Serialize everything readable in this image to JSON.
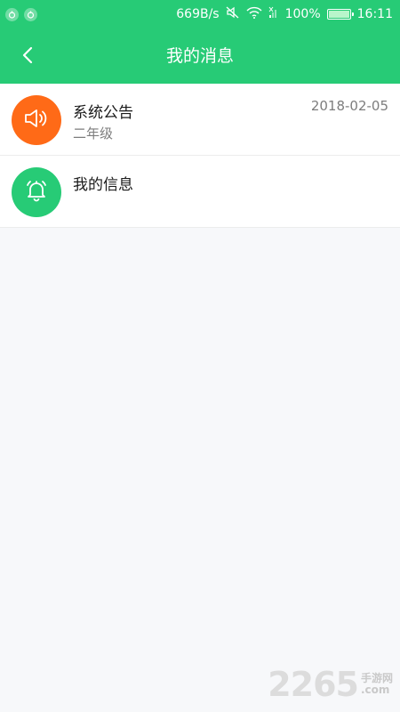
{
  "status_bar": {
    "network_speed": "669B/s",
    "battery_percent": "100%",
    "time": "16:11",
    "icons": [
      "app-icon",
      "app-icon",
      "mute-icon",
      "wifi-icon",
      "no-signal-icon",
      "battery-icon"
    ]
  },
  "header": {
    "title": "我的消息",
    "background_color": "#27cb76"
  },
  "messages": [
    {
      "title": "系统公告",
      "subtitle": "二年级",
      "date": "2018-02-05",
      "icon": "speaker-icon",
      "icon_color": "#ff6a17"
    },
    {
      "title": "我的信息",
      "subtitle": "",
      "date": "",
      "icon": "bell-icon",
      "icon_color": "#27cb76"
    }
  ],
  "watermark": {
    "number": "2265",
    "site_cn": "手游网",
    "site_en": ".com"
  }
}
